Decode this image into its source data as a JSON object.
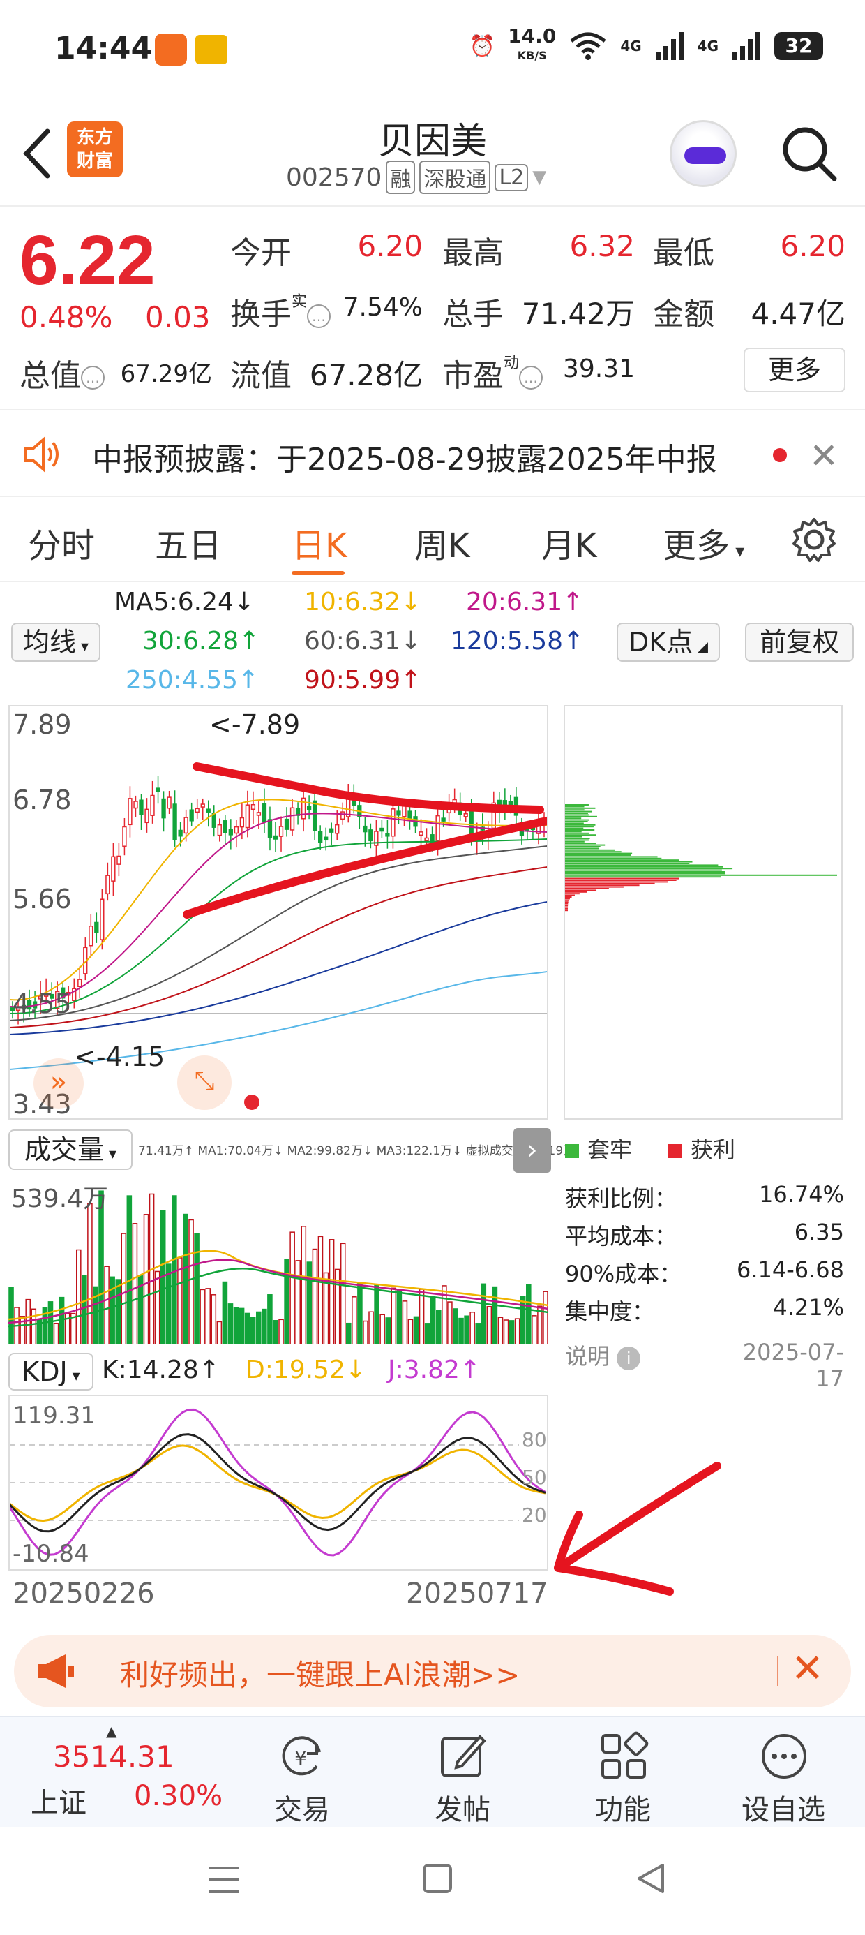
{
  "status_bar": {
    "time": "14:44",
    "net_speed_value": "14.0",
    "net_speed_unit": "KB/S",
    "sig1": "4G",
    "sig2": "4G",
    "battery": "32"
  },
  "header": {
    "brand_line1": "东方",
    "brand_line2": "财富",
    "title": "贝因美",
    "code": "002570",
    "tag_rong": "融",
    "tag_sgt": "深股通",
    "tag_l2": "L2"
  },
  "quote": {
    "price": "6.22",
    "change_pct": "0.48%",
    "change_val": "0.03",
    "open_label": "今开",
    "open": "6.20",
    "high_label": "最高",
    "high": "6.32",
    "low_label": "最低",
    "low": "6.20",
    "turnover_label": "换手",
    "turnover_sup": "实",
    "turnover": "7.54%",
    "volume_label": "总手",
    "volume": "71.42万",
    "amount_label": "金额",
    "amount": "4.47亿",
    "mktcap_label": "总值",
    "mktcap": "67.29亿",
    "float_label": "流值",
    "float": "67.28亿",
    "pe_label": "市盈",
    "pe_sup": "动",
    "pe": "39.31",
    "more": "更多"
  },
  "notice": {
    "text": "中报预披露：于2025-08-29披露2025年中报"
  },
  "tabs": [
    "分时",
    "五日",
    "日K",
    "周K",
    "月K",
    "更多"
  ],
  "ma_legend": {
    "selector": "均线",
    "ma5": "MA5:6.24↓",
    "ma10": "10:6.32↓",
    "ma20": "20:6.31↑",
    "ma30": "30:6.28↑",
    "ma60": "60:6.31↓",
    "ma120": "120:5.58↑",
    "ma250": "250:4.55↑",
    "ma90": "90:5.99↑",
    "dk_btn": "DK点",
    "adjust_btn": "前复权",
    "colors": {
      "ma5": "#222222",
      "ma10": "#f0b400",
      "ma20": "#c0188a",
      "ma30": "#11a43a",
      "ma60": "#555555",
      "ma120": "#1a3b9c",
      "ma250": "#58b7e8",
      "ma90": "#c0131a"
    }
  },
  "kline": {
    "y_labels": [
      "7.89",
      "6.78",
      "5.66",
      "4.55",
      "3.43"
    ],
    "high_marker": "<-7.89",
    "low_marker": "<-4.15"
  },
  "volume": {
    "selector": "成交量",
    "legend": "71.41万↑ MA1:70.04万↓ MA2:99.82万↓ MA3:122.1万↓ 虚拟成交量:77.19万",
    "max_label": "539.4万"
  },
  "kdj": {
    "selector": "KDJ",
    "k": "K:14.28↑",
    "d": "D:19.52↓",
    "j": "J:3.82↑",
    "y_top": "119.31",
    "y_bottom": "-10.84",
    "levels": [
      "80",
      "50",
      "20"
    ],
    "date_start": "20250226",
    "date_end": "20250717"
  },
  "chip": {
    "legend_trapped": "套牢",
    "legend_profit": "获利",
    "rows": [
      {
        "label": "获利比例：",
        "value": "16.74%"
      },
      {
        "label": "平均成本：",
        "value": "6.35"
      },
      {
        "label": "90%成本：",
        "value": "6.14-6.68"
      },
      {
        "label": "集中度：",
        "value": "4.21%"
      }
    ],
    "explain": "说明",
    "date": "2025-07-17"
  },
  "banner": {
    "text": "利好频出，一键跟上AI浪潮>>"
  },
  "bottom_bar": {
    "index_value": "3514.31",
    "index_name": "上证",
    "index_change": "0.30%",
    "items": [
      "交易",
      "发帖",
      "功能",
      "设自选"
    ]
  }
}
